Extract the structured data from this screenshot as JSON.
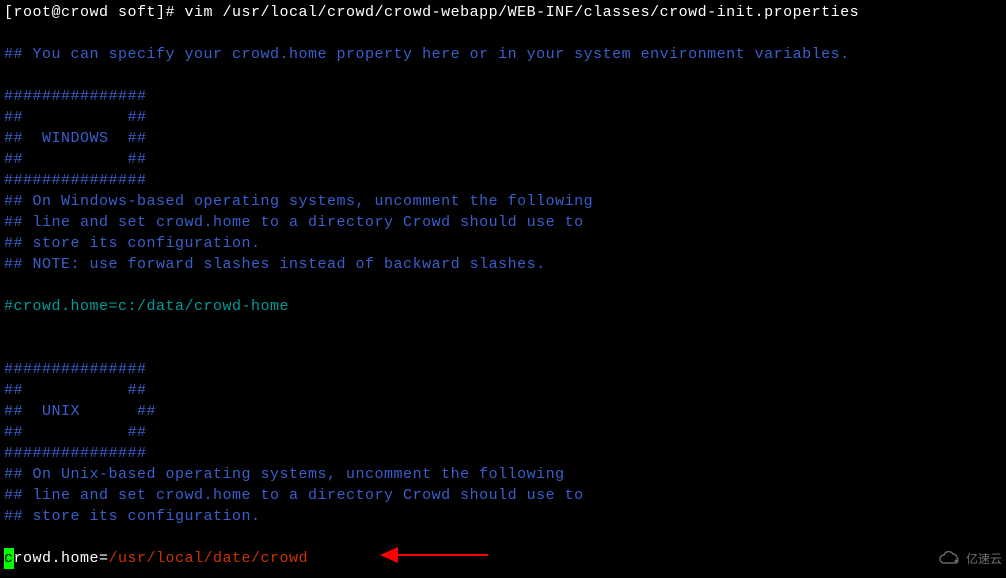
{
  "prompt": {
    "text": "[root@crowd soft]# vim /usr/local/crowd/crowd-webapp/WEB-INF/classes/crowd-init.properties"
  },
  "lines": {
    "header_comment": "## You can specify your crowd.home property here or in your system environment variables.",
    "win_border": "###############",
    "win_pad1": "##           ##",
    "win_title": "##  WINDOWS  ##",
    "win_pad2": "##           ##",
    "win1": "## On Windows-based operating systems, uncomment the following",
    "win2": "## line and set crowd.home to a directory Crowd should use to",
    "win3": "## store its configuration.",
    "win4": "## NOTE: use forward slashes instead of backward slashes.",
    "win_example": "#crowd.home=c:/data/crowd-home",
    "unix_border": "###############",
    "unix_pad1": "##           ##",
    "unix_title": "##  UNIX      ##",
    "unix_pad2": "##           ##",
    "unix1": "## On Unix-based operating systems, uncomment the following",
    "unix2": "## line and set crowd.home to a directory Crowd should use to",
    "unix3": "## store its configuration.",
    "prop_cursor_char": "c",
    "prop_key_rest": "rowd.home=",
    "prop_value": "/usr/local/date/crowd"
  },
  "watermark": {
    "text": "亿速云"
  }
}
